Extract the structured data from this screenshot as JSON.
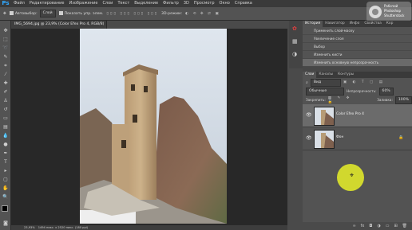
{
  "menubar": {
    "logo": "Ps",
    "items": [
      "Файл",
      "Редактирование",
      "Изображение",
      "Слои",
      "Текст",
      "Выделение",
      "Фильтр",
      "3D",
      "Просмотр",
      "Окно",
      "Справка"
    ]
  },
  "options": {
    "autoselect_label": "Автовыбор:",
    "autoselect_value": "Слой",
    "show_controls_label": "Показать упр. элем.",
    "mode_3d": "3D-режим:"
  },
  "document": {
    "tab_title": "IMG_5694.jpg @ 23,9% (Color Efex Pro 4, RGB/8) *",
    "zoom": "23,93%",
    "size_info": "1494 пикс. х 2520 пикс. (180 ppi)"
  },
  "watermark": {
    "line1": "Рабочий",
    "line2": "Photoshop",
    "line3": "Shutterstock"
  },
  "history_panel": {
    "tabs": [
      "История",
      "Навигатор",
      "Инфо",
      "Свойства",
      "Кор"
    ],
    "rows": [
      "Применить слой-маску",
      "Увеличение слоя",
      "Выбор",
      "Изменить кисти",
      "Изменить основную непрозрачность"
    ]
  },
  "layers_panel": {
    "tabs": [
      "Слои",
      "Каналы",
      "Контуры"
    ],
    "filter_label": "Вид",
    "blend_mode": "Обычные",
    "opacity_label": "Непрозрачность:",
    "opacity_value": "60%",
    "lock_label": "Закрепить:",
    "fill_label": "Заливка:",
    "fill_value": "100%",
    "layers": [
      {
        "name": "Color Efex Pro 4",
        "selected": true
      },
      {
        "name": "Фон",
        "selected": false
      }
    ]
  },
  "colors": {
    "accent": "#31a8ff",
    "cursor": "#e8f028"
  }
}
